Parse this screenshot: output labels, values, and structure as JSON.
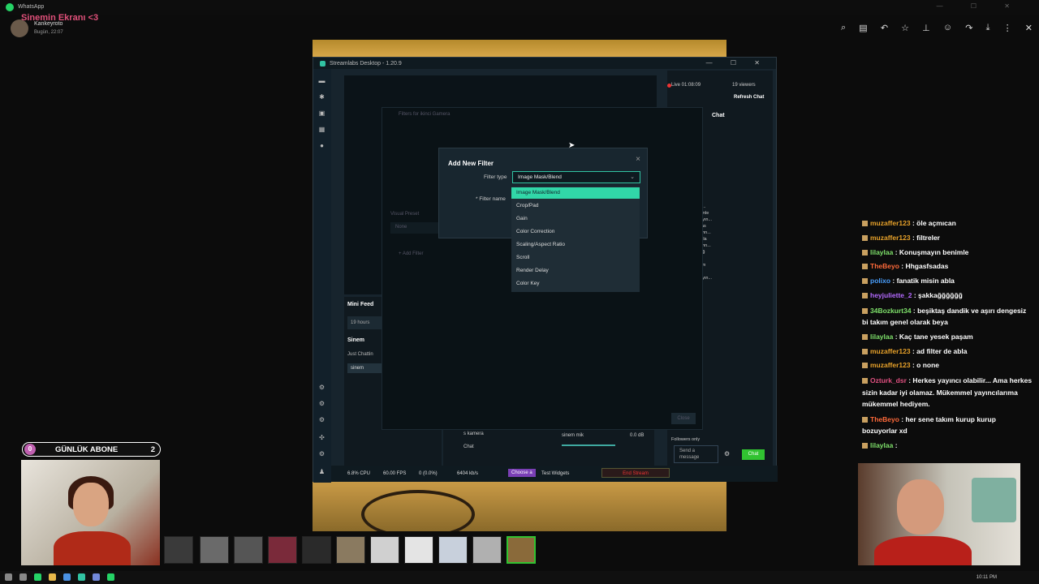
{
  "whatsapp": {
    "app_title": "WhatsApp",
    "overlay_title": "Sinemin Ekranı <3",
    "sender": "Kankeyroto",
    "time": "Bugün, 22:07",
    "window_controls": "— ☐ ✕"
  },
  "viewer_tools": [
    "zoom-in-icon",
    "caption-icon",
    "reply-icon",
    "star-icon",
    "pin-icon",
    "emoji-icon",
    "forward-icon",
    "download-icon",
    "more-icon",
    "close-icon"
  ],
  "streamlabs": {
    "title": "Streamlabs Desktop - 1.20.9",
    "controls": "— ☐ ✕",
    "mini_feed": {
      "title": "Mini Feed",
      "hours": "19 hours",
      "group": "Sinem",
      "just": "Just Chattin",
      "selected": "sinem"
    },
    "mixer": {
      "source1": "s kamera",
      "source2": "Chat",
      "mic": "sinem mik",
      "db": "0.0 dB"
    },
    "status": {
      "cpu": "6.8% CPU",
      "fps": "60.00 FPS",
      "dropped": "0 (0.0%)",
      "kbs": "6404 kb/s",
      "choose": "Choose a",
      "test": "Test Widgets",
      "end": "End Stream"
    },
    "chat": {
      "live": "Live 01:08:09",
      "viewers": "19 viewers",
      "refresh": "Refresh Chat",
      "header": "Chat",
      "lines": [
        "Ozturk_dsr",
        "baktığınızda",
        "açan o...",
        "llaylaa: OOURCA...",
        "Konuşmayın benimle",
        "lllaylaa: Konuşmayın...",
        "Beyo: Hhgasfsadas",
        "llaylaa: Konuşmayın...",
        "o: fanatik misin abla",
        "llaylaa: Konuşmayın...",
        "te_2: şakkağğğğğğ",
        "rt34: beşiktaş",
        "n dengesiz bi takım",
        "beya",
        "lllaylaa: Konuşmayın...",
        "Kaç tane yesek"
      ],
      "followers": "Followers only",
      "send": "Send a message",
      "chat_btn": "Chat"
    },
    "filters": {
      "title": "Filters for ikinci Gamera",
      "visual_preset": "Visual Preset",
      "preset_value": "None",
      "add_filter": "+ Add Filter",
      "close": "Close"
    },
    "add_filter": {
      "title": "Add New Filter",
      "type_label": "Filter type",
      "type_value": "Image Mask/Blend",
      "name_label": "* Filter name",
      "options": [
        "Image Mask/Blend",
        "Crop/Pad",
        "Gain",
        "Color Correction",
        "Scaling/Aspect Ratio",
        "Scroll",
        "Render Delay",
        "Color Key"
      ]
    }
  },
  "overlay_chat": [
    {
      "user": "muzaffer123",
      "color": "#e8a22a",
      "msg": "öle açmıcan"
    },
    {
      "user": "muzaffer123",
      "color": "#e8a22a",
      "msg": "filtreler"
    },
    {
      "user": "lilaylaa",
      "color": "#7ee06a",
      "msg": "Konuşmayın benimle"
    },
    {
      "user": "TheBeyo",
      "color": "#ff6a3a",
      "msg": "Hhgasfsadas"
    },
    {
      "user": "polixo",
      "color": "#4aa0ff",
      "msg": "fanatik misin abla"
    },
    {
      "user": "heyjuliette_2",
      "color": "#b46aff",
      "msg": "şakkağğğğğğ"
    },
    {
      "user": "34Bozkurt34",
      "color": "#7ee06a",
      "msg": "beşiktaş dandik ve aşırı dengesiz bi takım genel olarak beya"
    },
    {
      "user": "lilaylaa",
      "color": "#7ee06a",
      "msg": "Kaç tane yesek paşam"
    },
    {
      "user": "muzaffer123",
      "color": "#e8a22a",
      "msg": "ad filter de abla"
    },
    {
      "user": "muzaffer123",
      "color": "#e8a22a",
      "msg": "o none"
    },
    {
      "user": "Ozturk_dsr",
      "color": "#e05080",
      "msg": "Herkes yayıncı olabilir... Ama herkes sizin kadar iyi olamaz. Mükemmel yayıncılarıma mükemmel hediyem."
    },
    {
      "user": "TheBeyo",
      "color": "#ff6a3a",
      "msg": "her sene takım kurup kurup bozuyorlar xd"
    },
    {
      "user": "lilaylaa",
      "color": "#7ee06a",
      "msg": ""
    }
  ],
  "abone": {
    "left": "0",
    "label": "GÜNLÜK ABONE",
    "right": "2"
  },
  "taskbar": {
    "time": "10:11 PM"
  }
}
